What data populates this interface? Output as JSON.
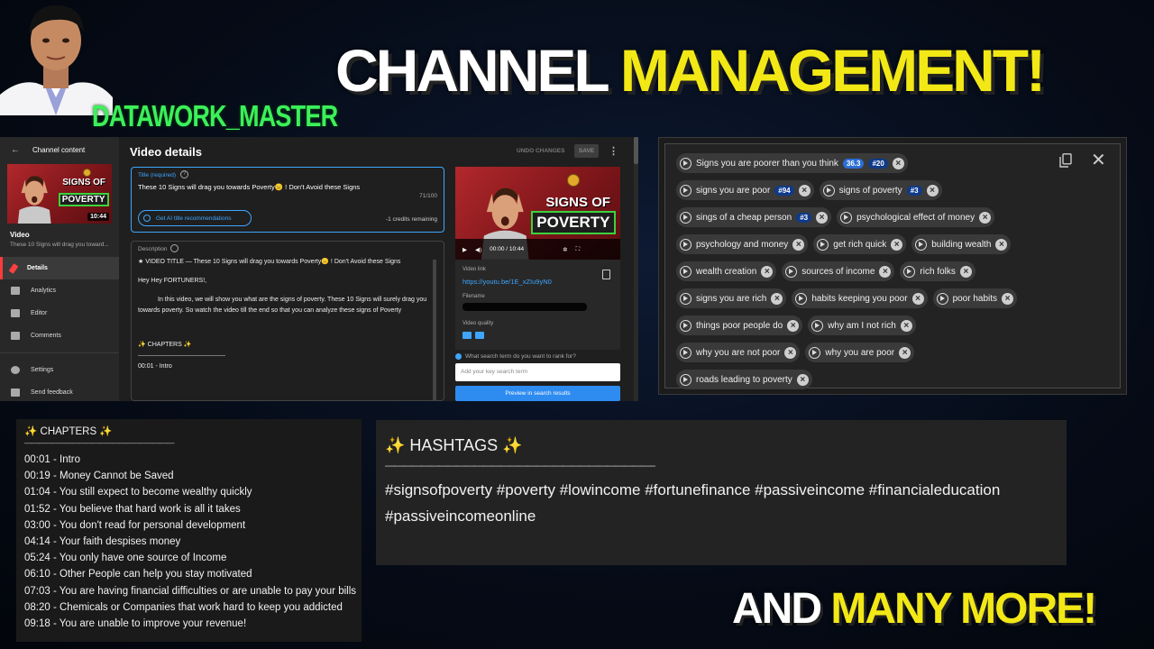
{
  "brand": {
    "handle": "DATAWORK_MASTER"
  },
  "headline": {
    "part1": "CHANNEL",
    "part2": "MANAGEMENT!"
  },
  "footer": {
    "part1": "AND",
    "part2": "MANY MORE!"
  },
  "studio": {
    "back_label": "Channel content",
    "page_title": "Video details",
    "undo_label": "UNDO CHANGES",
    "save_label": "SAVE",
    "video_label": "Video",
    "video_subtitle": "These 10 Signs will drag you toward...",
    "thumb_duration": "10:44",
    "nav": [
      {
        "label": "Details"
      },
      {
        "label": "Analytics"
      },
      {
        "label": "Editor"
      },
      {
        "label": "Comments"
      },
      {
        "label": "Settings"
      },
      {
        "label": "Send feedback"
      }
    ],
    "title_field": {
      "label": "Title (required)",
      "value": "These 10 Signs will drag you towards Poverty😑 !  Don't Avoid these Signs",
      "count": "71/100"
    },
    "ai_button_label": "Get AI title recommendations",
    "credits_label": "-1 credits remaining",
    "description_label": "Description",
    "description_lines": [
      "★ VIDEO TITLE — These 10 Signs will drag you towards Poverty😑 !  Don't Avoid these Signs",
      "Hey Hey FORTUNERS!,",
      "In this video, we will show you what are the signs of poverty. These 10 Signs will surely drag you towards poverty. So watch the video till the end so that you can analyze these signs of Poverty",
      "✨ CHAPTERS ✨",
      "————————————————",
      "00:01 - Intro"
    ],
    "player_time": "00:00 / 10:44",
    "video_link_label": "Video link",
    "video_link": "https://youtu.be/1E_xZIu9yN0",
    "filename_label": "Filename",
    "quality_label": "Video quality",
    "search_hint": "What search term do you want to rank for?",
    "keyword_placeholder": "Add your key search term",
    "preview_label": "Preview in search results"
  },
  "thumbnail": {
    "signs": "SIGNS OF",
    "poverty": "POVERTY"
  },
  "tags": [
    {
      "text": "Signs you are poorer than you think",
      "badges": [
        "36.3",
        "#20"
      ]
    },
    {
      "text": "signs you are poor",
      "badges": [
        "#94"
      ]
    },
    {
      "text": "signs of poverty",
      "badges": [
        "#3"
      ]
    },
    {
      "text": "sings of a cheap person",
      "badges": [
        "#3"
      ]
    },
    {
      "text": "psychological effect of money",
      "badges": []
    },
    {
      "text": "psychology and money",
      "badges": []
    },
    {
      "text": "get rich quick",
      "badges": []
    },
    {
      "text": "building wealth",
      "badges": []
    },
    {
      "text": "wealth creation",
      "badges": []
    },
    {
      "text": "sources of income",
      "badges": []
    },
    {
      "text": "rich folks",
      "badges": []
    },
    {
      "text": "signs you are rich",
      "badges": []
    },
    {
      "text": "habits keeping you poor",
      "badges": []
    },
    {
      "text": "poor habits",
      "badges": []
    },
    {
      "text": "things poor people do",
      "badges": []
    },
    {
      "text": "why am I not rich",
      "badges": []
    },
    {
      "text": "why you are not poor",
      "badges": []
    },
    {
      "text": "why you are poor",
      "badges": []
    },
    {
      "text": "roads leading to poverty",
      "badges": []
    }
  ],
  "chapters": {
    "heading": "✨ CHAPTERS ✨",
    "rule": "——————————————————————",
    "items": [
      "00:01 - Intro",
      "00:19 - Money Cannot be Saved",
      "01:04 - You still expect to become wealthy quickly",
      "01:52 - You believe that hard work is all it takes",
      "03:00 - You don't read for personal development",
      "04:14 - Your faith despises money",
      "05:24 - You only have one source of Income",
      "06:10 - Other People can help you stay motivated",
      "07:03 - You are having financial difficulties or are unable to pay your bills",
      "08:20 - Chemicals or Companies that work hard to keep you addicted",
      "09:18 - You are unable to improve your revenue!"
    ]
  },
  "hashtags": {
    "heading": "✨ HASHTAGS ✨",
    "rule": "————————————————————————————————————",
    "text": "#signsofpoverty #poverty  #lowincome  #fortunefinance #passiveincome #financialeducation #passiveincomeonline"
  },
  "colors": {
    "accent_yellow": "#f2e816",
    "brand_green": "#3cf05a",
    "youtube_blue": "#3ea6ff",
    "tag_badge_blue": "#2b6ed6"
  }
}
